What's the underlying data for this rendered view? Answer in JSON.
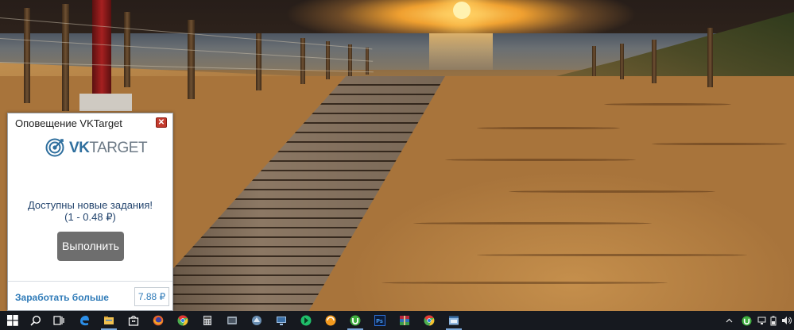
{
  "notification": {
    "title": "Оповещение VKTarget",
    "logo_prefix": "VK",
    "logo_suffix": "TARGET",
    "message_line1": "Доступны новые задания!",
    "message_line2": "(1 - 0.48 ₽)",
    "run_button": "Выполнить",
    "earn_more_link": "Заработать больше",
    "balance": "7.88 ₽",
    "close_icon": "close-icon"
  },
  "taskbar": {
    "items": [
      {
        "name": "start-icon",
        "color": "#ffffff"
      },
      {
        "name": "search-icon",
        "color": "#ffffff"
      },
      {
        "name": "task-view-icon",
        "color": "#ffffff"
      },
      {
        "name": "edge-icon",
        "color": "#2b8ee8"
      },
      {
        "name": "file-explorer-icon",
        "color": "#f2c14e"
      },
      {
        "name": "store-icon",
        "color": "#ffffff"
      },
      {
        "name": "firefox-icon",
        "color": "#e8642c"
      },
      {
        "name": "chrome-icon",
        "color": "#4caf50"
      },
      {
        "name": "calculator-icon",
        "color": "#cfd3d8"
      },
      {
        "name": "app-icon",
        "color": "#9aa6b2"
      },
      {
        "name": "remote-desktop-icon",
        "color": "#9fc3e8"
      },
      {
        "name": "green-app-icon",
        "color": "#1fbf6a"
      },
      {
        "name": "orange-app-icon",
        "color": "#f39a1e"
      },
      {
        "name": "utorrent-icon",
        "color": "#3fae3f"
      },
      {
        "name": "photoshop-icon",
        "color": "#2c6fd8"
      },
      {
        "name": "winrar-icon",
        "color": "#b5273c"
      },
      {
        "name": "chrome-icon",
        "color": "#4caf50"
      },
      {
        "name": "window-app-icon",
        "color": "#8fb7e0"
      }
    ],
    "tray": [
      {
        "name": "chevron-up-icon",
        "color": "#e6e6e6"
      },
      {
        "name": "utorrent-tray-icon",
        "color": "#3fae3f"
      },
      {
        "name": "network-icon",
        "color": "#e6e6e6"
      },
      {
        "name": "battery-icon",
        "color": "#e6e6e6"
      },
      {
        "name": "volume-icon",
        "color": "#e6e6e6"
      }
    ]
  }
}
